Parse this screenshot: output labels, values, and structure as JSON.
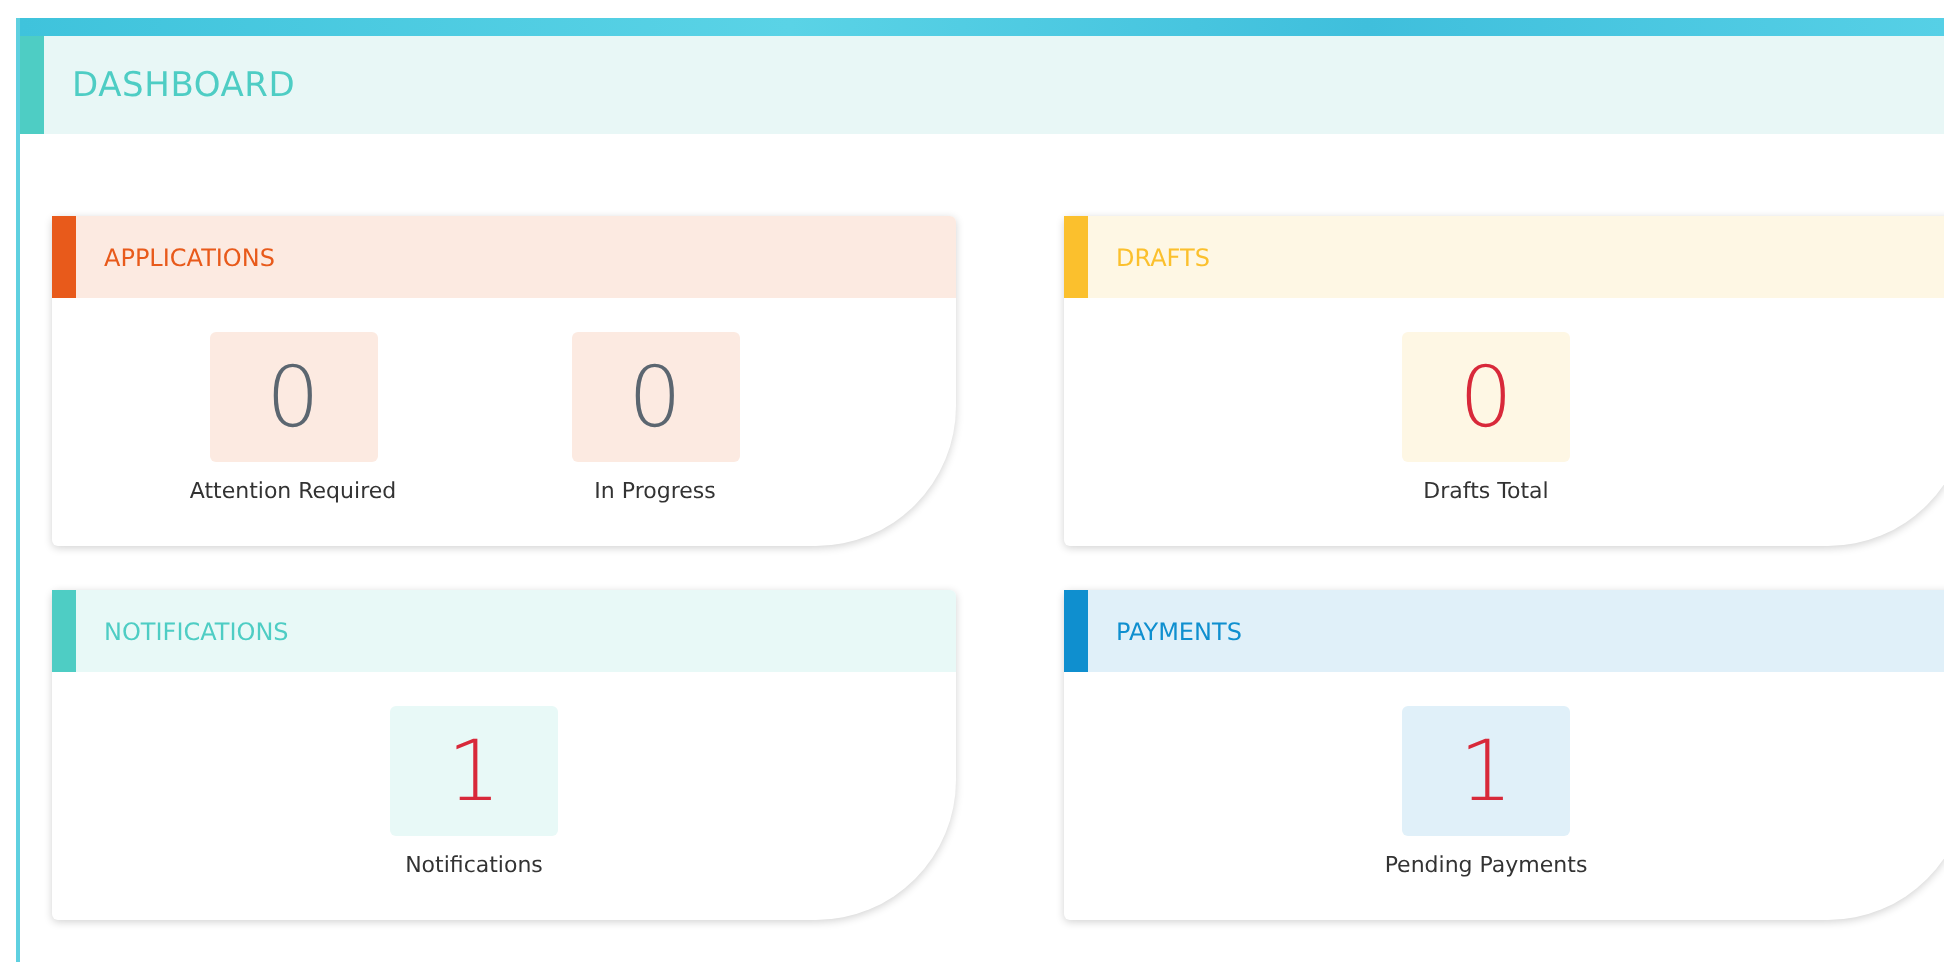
{
  "page": {
    "title": "DASHBOARD"
  },
  "cards": [
    {
      "title": "APPLICATIONS",
      "color": "#e85a1b",
      "stats": [
        {
          "value": "0",
          "label": "Attention Required",
          "emphasis": false
        },
        {
          "value": "0",
          "label": "In Progress",
          "emphasis": false
        }
      ]
    },
    {
      "title": "DRAFTS",
      "color": "#fbc02d",
      "stats": [
        {
          "value": "0",
          "label": "Drafts Total",
          "emphasis": true
        }
      ]
    },
    {
      "title": "NOTIFICATIONS",
      "color": "#4ecdc4",
      "stats": [
        {
          "value": "1",
          "label": "Notifications",
          "emphasis": true
        }
      ]
    },
    {
      "title": "PAYMENTS",
      "color": "#0f8fcf",
      "stats": [
        {
          "value": "1",
          "label": "Pending Payments",
          "emphasis": true
        }
      ]
    }
  ]
}
